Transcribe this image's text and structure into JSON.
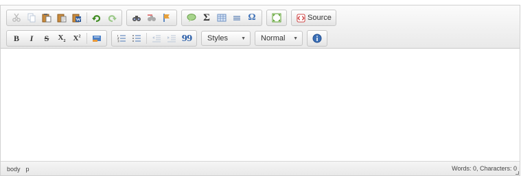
{
  "toolbar": {
    "source_label": "Source",
    "styles_value": "Styles",
    "format_value": "Normal",
    "bold_glyph": "B",
    "italic_glyph": "I",
    "strike_glyph": "S",
    "subscript_glyph": "X",
    "superscript_glyph": "X",
    "blockquote_glyph": "99",
    "sigma_glyph": "Σ",
    "omega_glyph": "Ω"
  },
  "statusbar": {
    "path": [
      "body",
      "p"
    ],
    "counter": "Words: 0, Characters: 0"
  },
  "colors": {
    "toolbar_bg": "#efefef",
    "border": "#c6c6c6",
    "accent_blue": "#3b6fb6",
    "accent_green": "#5aa02c",
    "accent_red": "#c33"
  }
}
